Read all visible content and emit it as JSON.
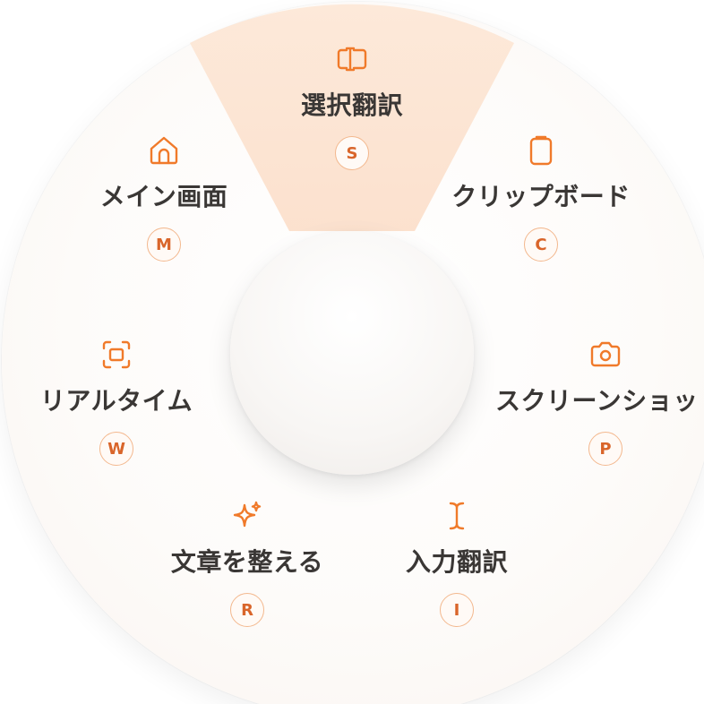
{
  "accent_color": "#f07a2a",
  "highlight_color": "#fde3cf",
  "menu": {
    "items": [
      {
        "id": "select-translate",
        "label": "選択翻訳",
        "key": "S",
        "icon": "text-cursor-box-icon"
      },
      {
        "id": "clipboard",
        "label": "クリップボード",
        "key": "C",
        "icon": "clipboard-icon"
      },
      {
        "id": "screenshot",
        "label": "スクリーンショッ",
        "key": "P",
        "icon": "camera-icon"
      },
      {
        "id": "input-translate",
        "label": "入力翻訳",
        "key": "I",
        "icon": "i-beam-cursor-icon"
      },
      {
        "id": "polish-text",
        "label": "文章を整える",
        "key": "R",
        "icon": "sparkles-icon"
      },
      {
        "id": "realtime",
        "label": "リアルタイム",
        "key": "W",
        "icon": "scan-frame-icon"
      },
      {
        "id": "main-screen",
        "label": "メイン画面",
        "key": "M",
        "icon": "home-icon"
      }
    ]
  }
}
